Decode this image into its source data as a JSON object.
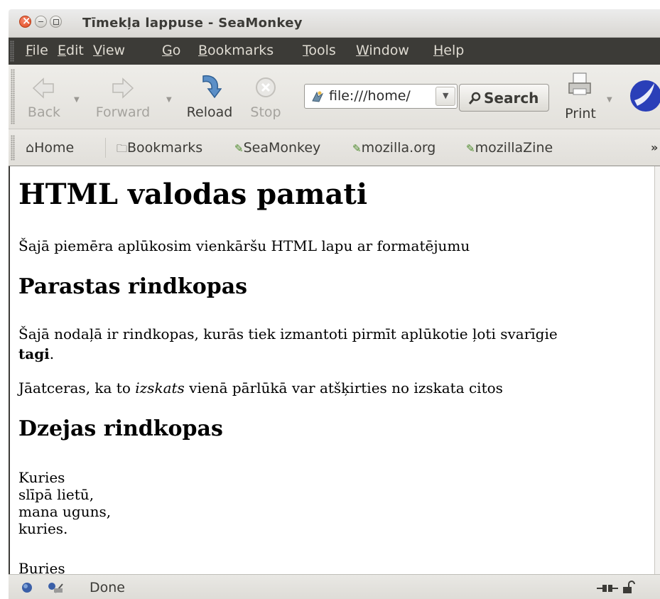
{
  "window": {
    "title": "Tīmekļa lappuse - SeaMonkey"
  },
  "menu": [
    {
      "label": "File",
      "u": "F",
      "rest": "ile"
    },
    {
      "label": "Edit",
      "u": "E",
      "rest": "dit"
    },
    {
      "label": "View",
      "u": "V",
      "rest": "iew"
    },
    {
      "label": "Go",
      "u": "G",
      "rest": "o"
    },
    {
      "label": "Bookmarks",
      "u": "B",
      "rest": "ookmarks"
    },
    {
      "label": "Tools",
      "u": "T",
      "rest": "ools"
    },
    {
      "label": "Window",
      "u": "W",
      "rest": "indow"
    },
    {
      "label": "Help",
      "u": "H",
      "rest": "elp"
    }
  ],
  "toolbar": {
    "back": "Back",
    "forward": "Forward",
    "reload": "Reload",
    "stop": "Stop",
    "url": "file:///home/",
    "search": "Search",
    "print": "Print"
  },
  "bookmarks": {
    "home": "Home",
    "bookmarks": "Bookmarks",
    "items": [
      "SeaMonkey",
      "mozilla.org",
      "mozillaZine"
    ]
  },
  "page": {
    "h1": "HTML valodas pamati",
    "intro": "Šajā piemēra aplūkosim vienkāršu HTML lapu ar formatējumu",
    "h2a": "Parastas rindkopas",
    "p1_line1": "Šajā nodaļā ir rindkopas, kurās tiek izmantoti pirmīt aplūkotie ļoti svarīgie",
    "p1_bold": "tagi",
    "p1_end": ".",
    "p2_before": "Jāatceras, ka to ",
    "p2_italic": "izskats",
    "p2_after": " vienā pārlūkā var atšķirties no izskata citos",
    "h2b": "Dzejas rindkopas",
    "poem": [
      "Kuries",
      "slīpā lietū,",
      "mana uguns,",
      "kuries.",
      "Buries"
    ]
  },
  "status": {
    "text": "Done"
  },
  "colors": {
    "menubar": "#3c3b37",
    "menu_text": "#dfdbd2",
    "close_button": "#e0481e"
  }
}
